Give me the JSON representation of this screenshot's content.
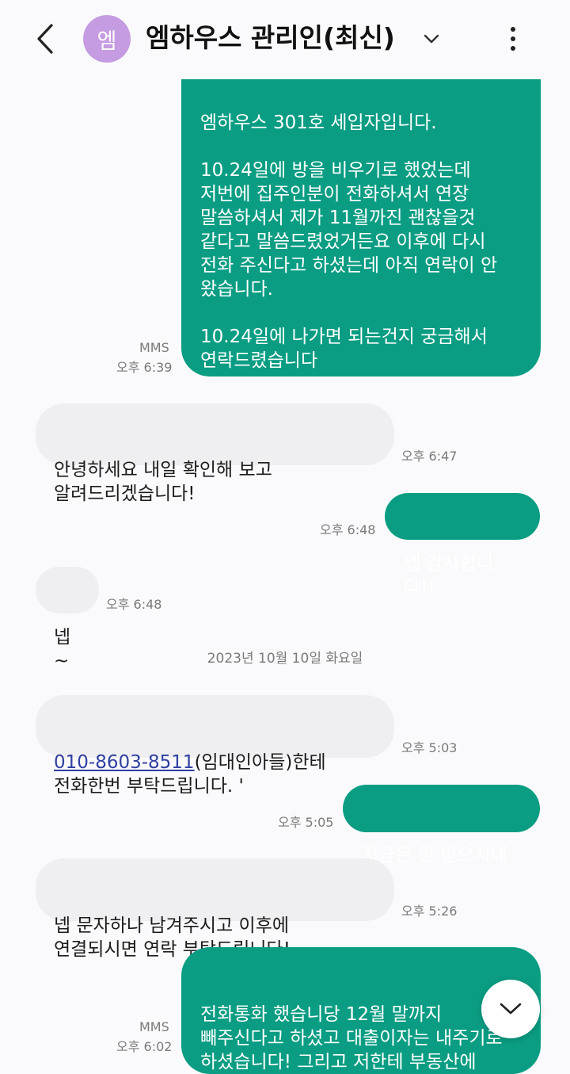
{
  "header": {
    "avatar_initial": "엠",
    "contact_name": "엠하우스 관리인(최신)",
    "avatar_color": "#c59be2"
  },
  "colors": {
    "outgoing_bubble": "#0a9d83",
    "incoming_bubble": "#efeff1"
  },
  "messages": [
    {
      "direction": "out",
      "text": "엠하우스 301호 세입자입니다.\n\n10.24일에 방을 비우기로 했었는데\n저번에 집주인분이 전화하셔서 연장\n말씀하셔서 제가 11월까진 괜찮을것\n같다고 말씀드렸었거든요 이후에 다시\n전화 주신다고 하셨는데 아직 연락이 안\n왔습니다.\n\n10.24일에 나가면 되는건지 궁금해서\n연락드렸습니다",
      "tag": "MMS",
      "time": "오후 6:39"
    },
    {
      "direction": "in",
      "text": "안녕하세요 내일 확인해 보고\n알려드리겠습니다!",
      "time": "오후 6:47"
    },
    {
      "direction": "out",
      "text": "넵 감사합니다!!",
      "time": "오후 6:48"
    },
    {
      "direction": "in",
      "text": "넵~",
      "time": "오후 6:48"
    },
    {
      "direction": "in",
      "link": "010-8603-8511",
      "text_after_link": "(임대인아들)한테\n전화한번 부탁드립니다. '",
      "time": "오후 5:03"
    },
    {
      "direction": "out",
      "text": "지금은 안 받으시네용",
      "time": "오후 5:05"
    },
    {
      "direction": "in",
      "text": "넵 문자하나 남겨주시고 이후에\n연결되시면 연락 부탁드립니다!",
      "time": "오후 5:26"
    },
    {
      "direction": "out",
      "text": "전화통화 했습니당 12월 말까지\n빼주신다고 하셨고 대출이자는 내주기로\n하셨습니다! 그리고 저한테 부동산에\n등록해달라고 하시더라구요",
      "tag": "MMS",
      "time": "오후 6:02"
    }
  ],
  "date_separator": "2023년 10월 10일 화요일"
}
